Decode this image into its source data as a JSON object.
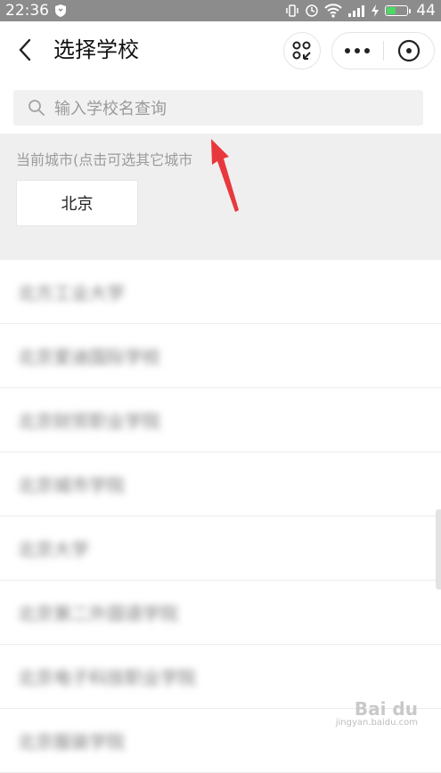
{
  "status_bar": {
    "time": "22:36",
    "battery": "44",
    "battery_level": 0.44,
    "icons": [
      "shield-icon",
      "vibrate-icon",
      "alarm-icon",
      "wifi-icon",
      "signal-icon",
      "charging-icon",
      "battery-icon"
    ]
  },
  "header": {
    "title": "选择学校",
    "icons": [
      "back-arrow-icon",
      "scan-icon",
      "more-icon",
      "close-icon"
    ]
  },
  "search": {
    "placeholder": "输入学校名查询",
    "icon": "search-icon"
  },
  "city": {
    "label": "当前城市(点击可选其它城市",
    "current": "北京"
  },
  "schools": [
    "北方工业大学",
    "北京爱迪国际学校",
    "北京财贸职业学院",
    "北京城市学院",
    "北京大学",
    "北京第二外国语学院",
    "北京电子科技职业学院",
    "北京服装学院"
  ],
  "watermark": {
    "brand": "Bai du",
    "sub": "jingyan.baidu.com"
  },
  "colors": {
    "status_bar": "#8c8c8c",
    "section_bg": "#efefef",
    "search_bg": "#f1f1f1",
    "arrow": "#e8383d",
    "battery": "#4cd964"
  }
}
